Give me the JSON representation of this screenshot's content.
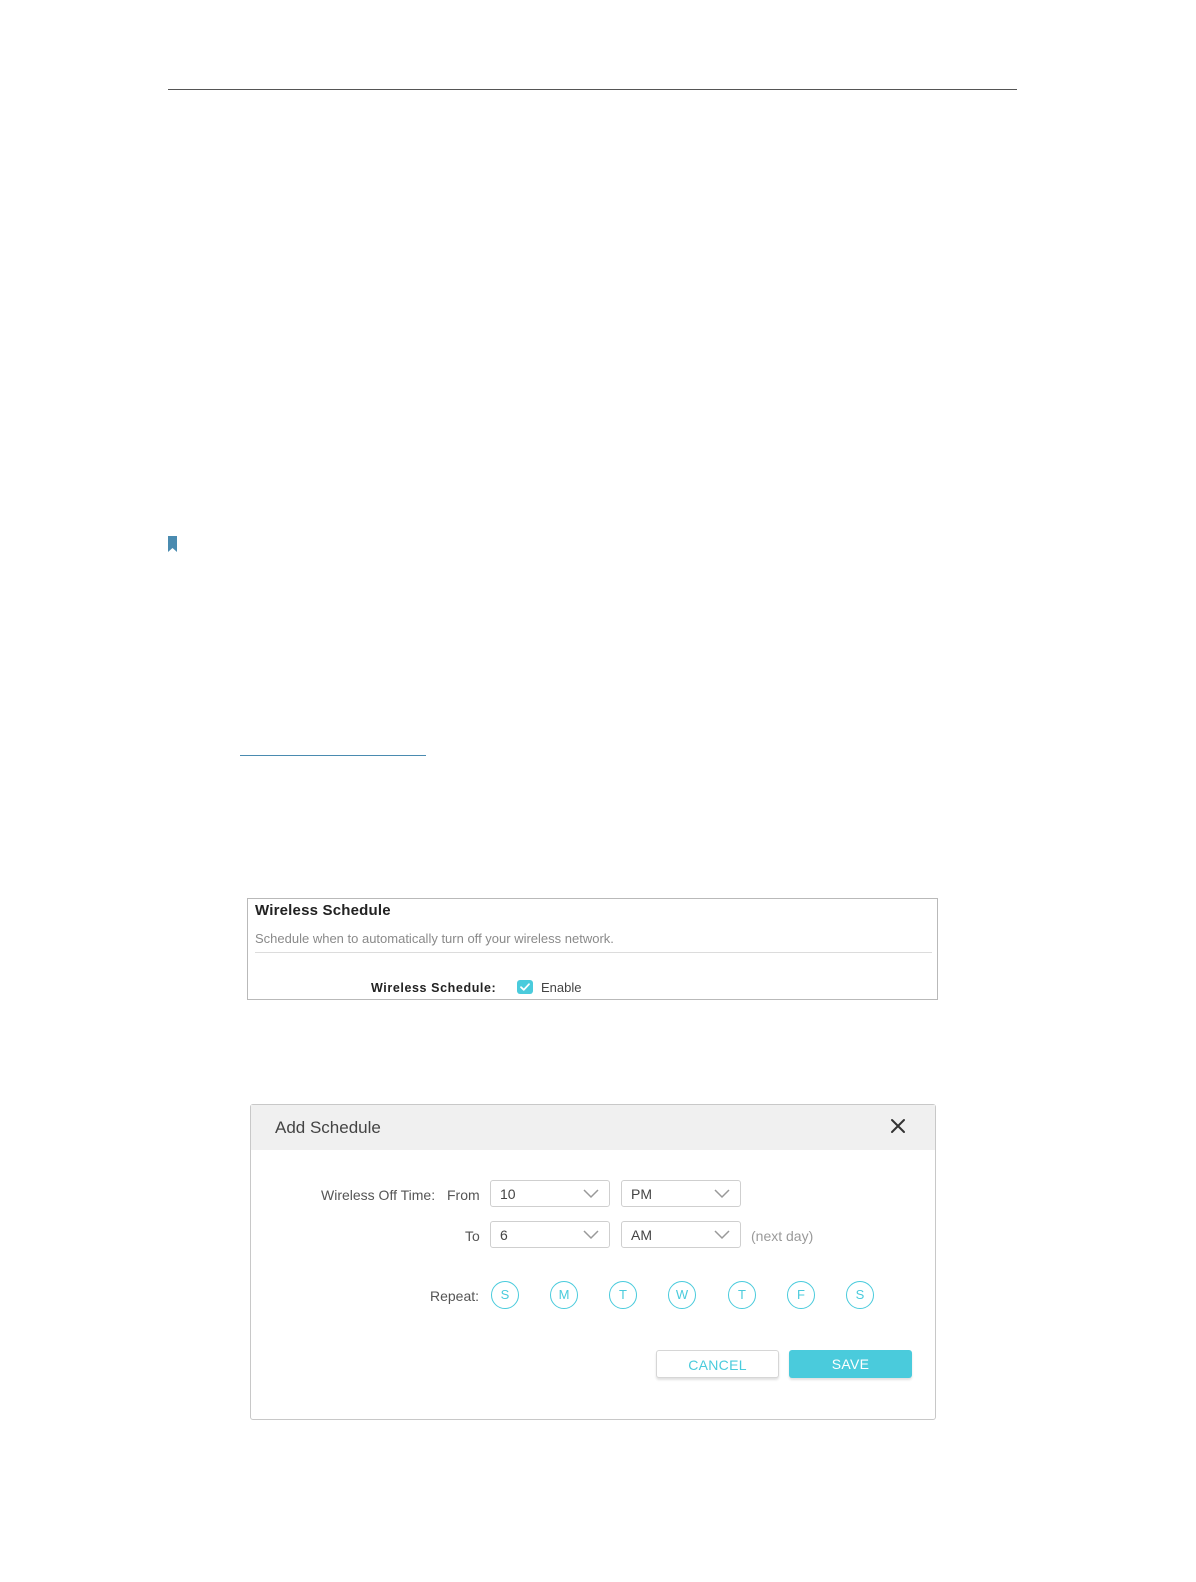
{
  "colors": {
    "accent": "#4acbdc",
    "bookmark": "#4a8bb0"
  },
  "wireless_schedule": {
    "title": "Wireless Schedule",
    "description": "Schedule when to automatically turn off your wireless network.",
    "label": "Wireless Schedule:",
    "enable_checked": true,
    "enable_label": "Enable"
  },
  "add_schedule": {
    "title": "Add Schedule",
    "off_time_label": "Wireless Off Time:",
    "from_label": "From",
    "to_label": "To",
    "from_hour": "10",
    "from_period": "PM",
    "to_hour": "6",
    "to_period": "AM",
    "next_day_hint": "(next day)",
    "repeat_label": "Repeat:",
    "days": [
      "S",
      "M",
      "T",
      "W",
      "T",
      "F",
      "S"
    ],
    "cancel_label": "CANCEL",
    "save_label": "SAVE"
  }
}
